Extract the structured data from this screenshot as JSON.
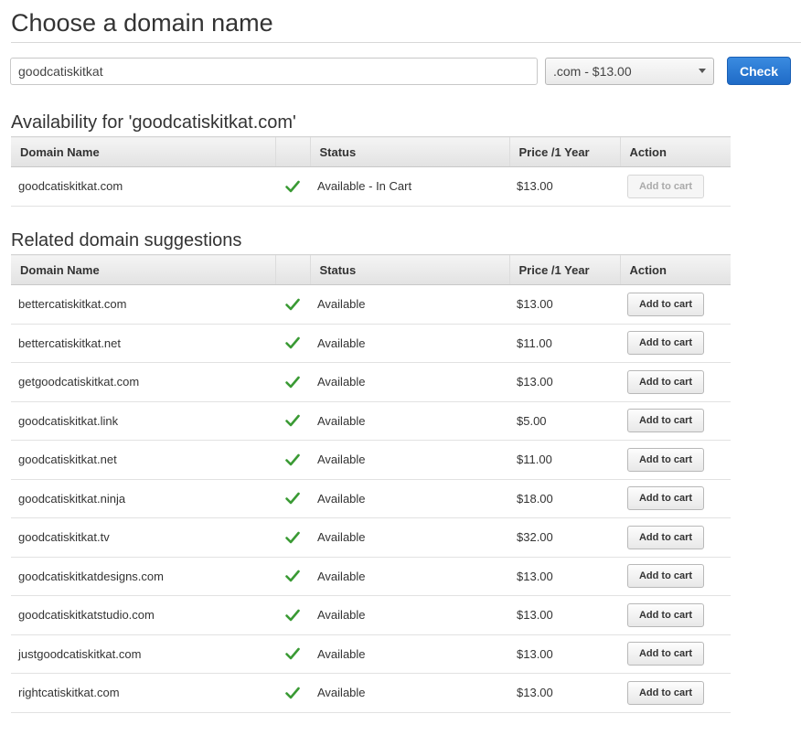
{
  "header": {
    "title": "Choose a domain name"
  },
  "search": {
    "value": "goodcatiskitkat",
    "tld_selected": ".com - $13.00",
    "check_label": "Check"
  },
  "availability": {
    "title": "Availability for 'goodcatiskitkat.com'",
    "columns": [
      "Domain Name",
      "",
      "Status",
      "Price /1 Year",
      "Action"
    ],
    "row": {
      "domain": "goodcatiskitkat.com",
      "status": "Available - In Cart",
      "price": "$13.00",
      "action": "Add to cart"
    }
  },
  "suggestions": {
    "title": "Related domain suggestions",
    "columns": [
      "Domain Name",
      "",
      "Status",
      "Price /1 Year",
      "Action"
    ],
    "rows": [
      {
        "domain": "bettercatiskitkat.com",
        "status": "Available",
        "price": "$13.00",
        "action": "Add to cart"
      },
      {
        "domain": "bettercatiskitkat.net",
        "status": "Available",
        "price": "$11.00",
        "action": "Add to cart"
      },
      {
        "domain": "getgoodcatiskitkat.com",
        "status": "Available",
        "price": "$13.00",
        "action": "Add to cart"
      },
      {
        "domain": "goodcatiskitkat.link",
        "status": "Available",
        "price": "$5.00",
        "action": "Add to cart"
      },
      {
        "domain": "goodcatiskitkat.net",
        "status": "Available",
        "price": "$11.00",
        "action": "Add to cart"
      },
      {
        "domain": "goodcatiskitkat.ninja",
        "status": "Available",
        "price": "$18.00",
        "action": "Add to cart"
      },
      {
        "domain": "goodcatiskitkat.tv",
        "status": "Available",
        "price": "$32.00",
        "action": "Add to cart"
      },
      {
        "domain": "goodcatiskitkatdesigns.com",
        "status": "Available",
        "price": "$13.00",
        "action": "Add to cart"
      },
      {
        "domain": "goodcatiskitkatstudio.com",
        "status": "Available",
        "price": "$13.00",
        "action": "Add to cart"
      },
      {
        "domain": "justgoodcatiskitkat.com",
        "status": "Available",
        "price": "$13.00",
        "action": "Add to cart"
      },
      {
        "domain": "rightcatiskitkat.com",
        "status": "Available",
        "price": "$13.00",
        "action": "Add to cart"
      }
    ]
  },
  "icons": {
    "available": "checkmark-icon",
    "dropdown": "chevron-down-icon"
  },
  "colors": {
    "primary": "#1f6bc7",
    "available": "#3a9a34"
  }
}
